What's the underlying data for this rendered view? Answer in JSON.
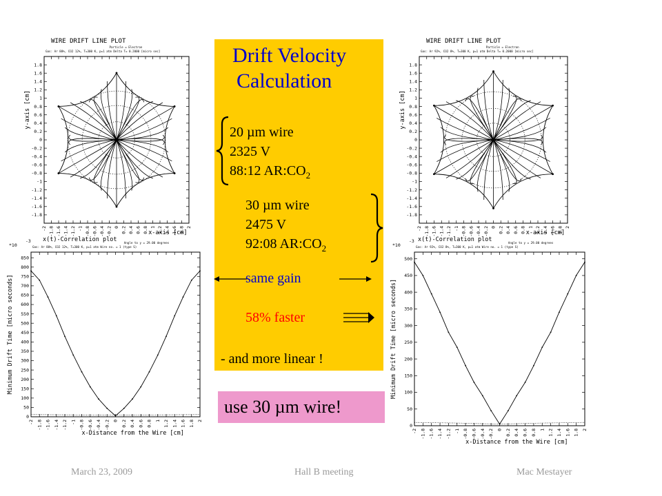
{
  "slide": {
    "panel_title_line1": "Drift Velocity",
    "panel_title_line2": "Calculation",
    "wire1": {
      "line1": "20 µm wire",
      "line2": "2325 V",
      "line3_main": "88:12 AR:CO",
      "line3_sub": "2"
    },
    "wire2": {
      "line1": "30 µm wire",
      "line2": "2475 V",
      "line3_main": "92:08 AR:CO",
      "line3_sub": "2"
    },
    "same_gain": "same gain",
    "faster": "58% faster",
    "linear": "- and more linear !",
    "conclusion": "use 30 µm wire!",
    "footer_left": "March 23, 2009",
    "footer_center": "Hall B meeting",
    "footer_right": "Mac Mestayer",
    "colors": {
      "panel": "#FFCC00",
      "conclusion_bg": "#EE99CC",
      "title_blue": "#0000CC",
      "gain_blue": "#0000CC",
      "faster_red": "#FF0000",
      "footer_gray": "#9a9a9a"
    }
  },
  "chart_data": [
    {
      "type": "line",
      "title": "WIRE DRIFT LINE PLOT",
      "subtitle_right": "Particle = Electron",
      "subtitle": "Gas: Ar 88%, CO2 12%, T=300 K, p=1 atm Delta T= 0.2000 [micro sec]",
      "xlabel": "x-axis [cm]",
      "ylabel": "y-axis [cm]",
      "footer_label": "x(t)-Correlation plot",
      "xlim": [
        -2,
        2
      ],
      "ylim": [
        -2,
        2
      ],
      "xticks": [
        "-2",
        "-1.8",
        "-1.6",
        "-1.4",
        "-1.2",
        "-1",
        "-0.8",
        "-0.6",
        "-0.4",
        "-0.2",
        "0",
        "0.2",
        "0.4",
        "0.6",
        "0.8",
        "1",
        "1.2",
        "1.4",
        "1.6",
        "1.8",
        "2"
      ],
      "yticks": [
        "-1.8",
        "-1.6",
        "-1.4",
        "-1.2",
        "-1",
        "-0.8",
        "-0.6",
        "-0.4",
        "-0.2",
        "0",
        "0.2",
        "0.4",
        "0.6",
        "0.8",
        "1",
        "1.2",
        "1.4",
        "1.6",
        "1.8"
      ],
      "hex_field": {
        "outer_radius": 1.85,
        "sector_count": 6,
        "isochron_radii": [
          0.5,
          0.95,
          1.35
        ]
      }
    },
    {
      "type": "line",
      "title": "WIRE DRIFT LINE PLOT",
      "subtitle_right": "Particle = Electron",
      "subtitle": "Gas: Ar 92%, CO2 8%, T=300 K, p=1 atm Delta T= 0.2000 [micro sec]",
      "xlabel": "x-axis [cm]",
      "ylabel": "y-axis [cm]",
      "footer_label": "x(t)-Correlation plot",
      "xlim": [
        -2,
        2
      ],
      "ylim": [
        -2,
        2
      ],
      "xticks": [
        "-2",
        "-1.8",
        "-1.6",
        "-1.4",
        "-1.2",
        "-1",
        "-0.8",
        "-0.6",
        "-0.4",
        "-0.2",
        "0",
        "0.2",
        "0.4",
        "0.6",
        "0.8",
        "1",
        "1.2",
        "1.4",
        "1.6",
        "1.8",
        "2"
      ],
      "yticks": [
        "-1.8",
        "-1.6",
        "-1.4",
        "-1.2",
        "-1",
        "-0.8",
        "-0.6",
        "-0.4",
        "-0.2",
        "0",
        "0.2",
        "0.4",
        "0.6",
        "0.8",
        "1",
        "1.2",
        "1.4",
        "1.6",
        "1.8"
      ],
      "hex_field": {
        "outer_radius": 1.85,
        "sector_count": 6,
        "isochron_radii": [
          0.45,
          0.85,
          1.3
        ]
      }
    },
    {
      "type": "line",
      "subtitle": "Gas: Ar 88%, CO2 12%, T=300 K, p=1 atm Wire no. = 1 (type S)",
      "subtitle_right": "Angle to y = 29.00 degrees",
      "exponent": "-3\n*10",
      "xlabel": "x-Distance from the Wire [cm]",
      "ylabel": "Minimum Drift Time [micro seconds]",
      "xlim": [
        -2,
        2
      ],
      "ylim": [
        0,
        880
      ],
      "xticks": [
        "-2",
        "-1.8",
        "-1.6",
        "-1.4",
        "-1.2",
        "-1",
        "-0.8",
        "-0.6",
        "-0.4",
        "-0.2",
        "0",
        "0.2",
        "0.4",
        "0.6",
        "0.8",
        "1",
        "1.2",
        "1.4",
        "1.6",
        "1.8",
        "2"
      ],
      "yticks": [
        0,
        50,
        100,
        150,
        200,
        250,
        300,
        350,
        400,
        450,
        500,
        550,
        600,
        650,
        700,
        750,
        800,
        850
      ],
      "series": [
        {
          "style": "solid",
          "x": [
            -2.0,
            -1.8,
            -1.6,
            -1.4,
            -1.2,
            -1.0,
            -0.8,
            -0.6,
            -0.4,
            -0.2,
            0.0,
            0.2,
            0.4,
            0.6,
            0.8,
            1.0,
            1.2,
            1.4,
            1.6,
            1.8,
            2.0
          ],
          "y": [
            780,
            730,
            640,
            540,
            430,
            330,
            240,
            160,
            95,
            45,
            5,
            45,
            95,
            160,
            240,
            330,
            430,
            540,
            640,
            730,
            780
          ]
        },
        {
          "style": "dotted",
          "x": [
            -2.0,
            -1.0,
            0.0,
            1.0,
            2.0
          ],
          "y": [
            12,
            10,
            9,
            10,
            12
          ]
        }
      ]
    },
    {
      "type": "line",
      "subtitle": "Gas: Ar 92%, CO2 8%, T=300 K, p=1 atm Wire no. = 1 (type S)",
      "subtitle_right": "Angle to y = 29.00 degrees",
      "exponent": "-3\n*10",
      "xlabel": "x-Distance from the Wire [cm]",
      "ylabel": "Minimum Drift Time [micro seconds]",
      "xlim": [
        -2,
        2
      ],
      "ylim": [
        0,
        520
      ],
      "xticks": [
        "-2",
        "-1.8",
        "-1.6",
        "-1.4",
        "-1.2",
        "-1",
        "-0.8",
        "-0.6",
        "-0.4",
        "-0.2",
        "0",
        "0.2",
        "0.4",
        "0.6",
        "0.8",
        "1",
        "1.2",
        "1.4",
        "1.6",
        "1.8",
        "2"
      ],
      "yticks": [
        0,
        50,
        100,
        150,
        200,
        250,
        300,
        350,
        400,
        450,
        500
      ],
      "series": [
        {
          "style": "solid",
          "x": [
            -2.0,
            -1.8,
            -1.6,
            -1.4,
            -1.2,
            -1.0,
            -0.8,
            -0.6,
            -0.4,
            -0.2,
            0.0,
            0.2,
            0.4,
            0.6,
            0.8,
            1.0,
            1.2,
            1.4,
            1.6,
            1.8,
            2.0
          ],
          "y": [
            490,
            450,
            395,
            340,
            280,
            235,
            180,
            130,
            90,
            45,
            5,
            45,
            90,
            130,
            180,
            235,
            280,
            340,
            395,
            450,
            490
          ]
        },
        {
          "style": "dotted",
          "x": [
            -2.0,
            -1.0,
            0.0,
            1.0,
            2.0
          ],
          "y": [
            10,
            8,
            5,
            8,
            10
          ]
        }
      ]
    }
  ]
}
